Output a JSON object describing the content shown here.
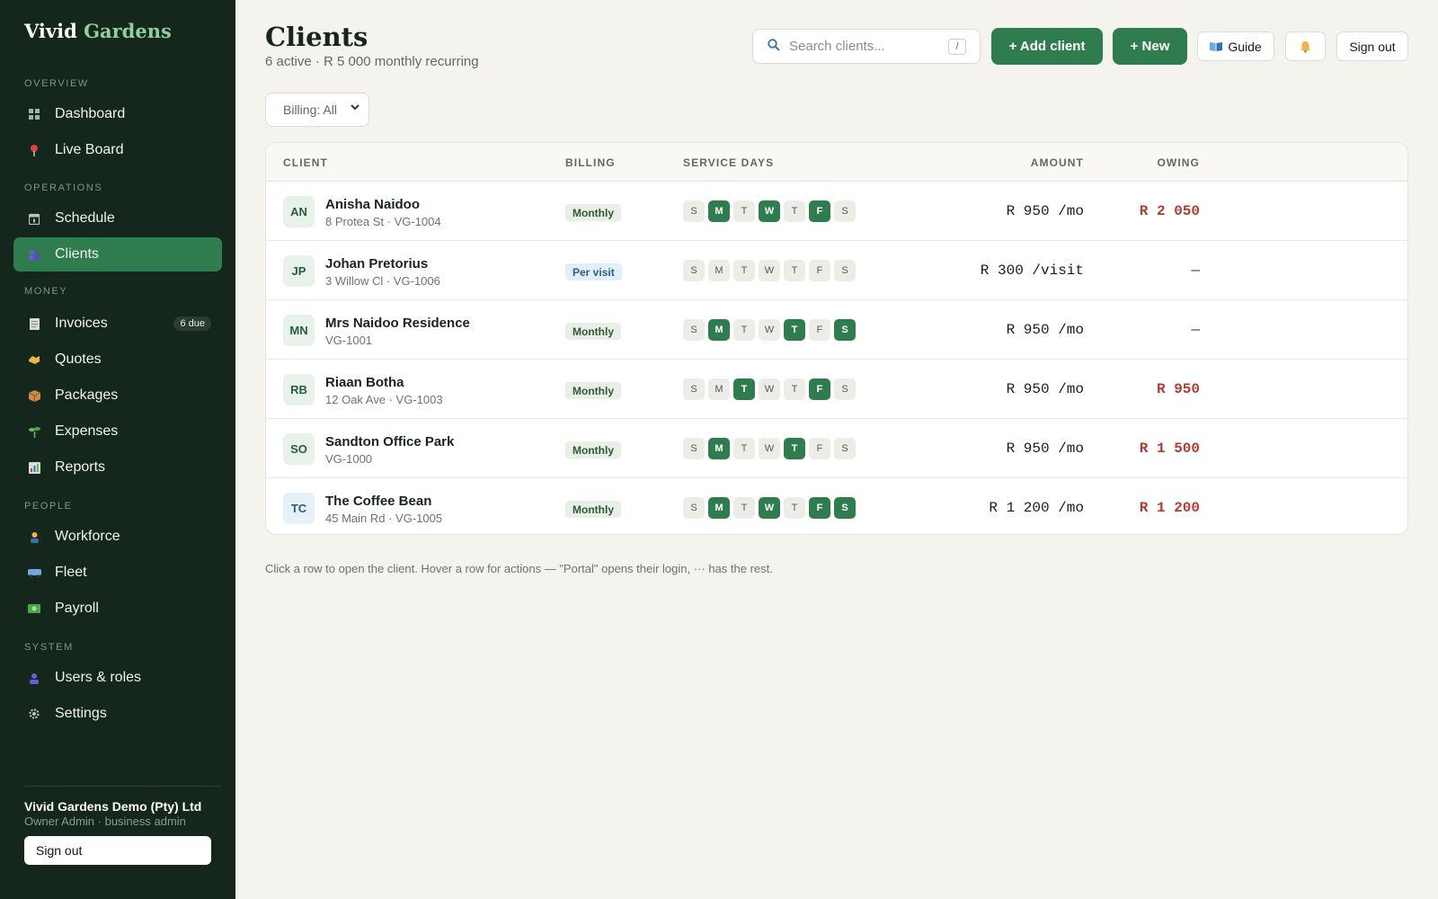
{
  "brand": {
    "name": "Vivid",
    "accent": "Gardens"
  },
  "sidebar": {
    "sections": [
      {
        "label": "OVERVIEW",
        "items": [
          {
            "label": "Dashboard",
            "icon": "grid-icon"
          },
          {
            "label": "Live Board",
            "icon": "pin-icon"
          }
        ]
      },
      {
        "label": "OPERATIONS",
        "items": [
          {
            "label": "Schedule",
            "icon": "calendar-icon"
          },
          {
            "label": "Clients",
            "icon": "people-icon",
            "active": true
          }
        ]
      },
      {
        "label": "MONEY",
        "items": [
          {
            "label": "Invoices",
            "icon": "receipt-icon",
            "badge": "6 due"
          },
          {
            "label": "Quotes",
            "icon": "handshake-icon"
          },
          {
            "label": "Packages",
            "icon": "package-icon"
          },
          {
            "label": "Expenses",
            "icon": "sprout-icon"
          },
          {
            "label": "Reports",
            "icon": "chart-icon"
          }
        ]
      },
      {
        "label": "PEOPLE",
        "items": [
          {
            "label": "Workforce",
            "icon": "worker-icon"
          },
          {
            "label": "Fleet",
            "icon": "van-icon"
          },
          {
            "label": "Payroll",
            "icon": "cash-icon"
          }
        ]
      },
      {
        "label": "SYSTEM",
        "items": [
          {
            "label": "Users & roles",
            "icon": "user-icon"
          },
          {
            "label": "Settings",
            "icon": "gear-icon"
          }
        ]
      }
    ],
    "org_name": "Vivid Gardens Demo (Pty) Ltd",
    "org_role": "Owner Admin · business admin",
    "sign_out": "Sign out"
  },
  "header": {
    "title": "Clients",
    "subtitle": "6 active · R 5 000 monthly recurring",
    "search_placeholder": "Search clients...",
    "search_shortcut": "/",
    "add_client": "+ Add client",
    "new": "+ New",
    "guide": "Guide",
    "sign_out": "Sign out"
  },
  "filter": {
    "label": "Billing: All"
  },
  "table": {
    "columns": {
      "client": "CLIENT",
      "billing": "BILLING",
      "service_days": "SERVICE DAYS",
      "amount": "AMOUNT",
      "owing": "OWING"
    },
    "day_letters": [
      "S",
      "M",
      "T",
      "W",
      "T",
      "F",
      "S"
    ],
    "rows": [
      {
        "initials": "AN",
        "name": "Anisha Naidoo",
        "address": "8 Protea St · VG-1004",
        "billing": "Monthly",
        "days": [
          0,
          1,
          0,
          1,
          0,
          1,
          0
        ],
        "amount": "R 950 /mo",
        "owing": "R 2 050"
      },
      {
        "initials": "JP",
        "name": "Johan Pretorius",
        "address": "3 Willow Cl · VG-1006",
        "billing": "Per visit",
        "days": [
          0,
          0,
          0,
          0,
          0,
          0,
          0
        ],
        "amount": "R 300 /visit",
        "owing": "—"
      },
      {
        "initials": "MN",
        "name": "Mrs Naidoo Residence",
        "address": "VG-1001",
        "billing": "Monthly",
        "days": [
          0,
          1,
          0,
          0,
          1,
          0,
          1
        ],
        "amount": "R 950 /mo",
        "owing": "—"
      },
      {
        "initials": "RB",
        "name": "Riaan Botha",
        "address": "12 Oak Ave · VG-1003",
        "billing": "Monthly",
        "days": [
          0,
          0,
          1,
          0,
          0,
          1,
          0
        ],
        "amount": "R 950 /mo",
        "owing": "R 950"
      },
      {
        "initials": "SO",
        "name": "Sandton Office Park",
        "address": "VG-1000",
        "billing": "Monthly",
        "days": [
          0,
          1,
          0,
          0,
          1,
          0,
          0
        ],
        "amount": "R 950 /mo",
        "owing": "R 1 500"
      },
      {
        "initials": "TC",
        "name": "The Coffee Bean",
        "address": "45 Main Rd · VG-1005",
        "billing": "Monthly",
        "days": [
          0,
          1,
          0,
          1,
          0,
          1,
          1
        ],
        "amount": "R 1 200 /mo",
        "owing": "R 1 200"
      }
    ]
  },
  "hint": "Click a row to open the client. Hover a row for actions — \"Portal\" opens their login, ··· has the rest.",
  "colors": {
    "sidebar_bg": "#15261c",
    "accent_green": "#2f7d4f",
    "owing_red": "#b23b32",
    "page_bg": "#f4f3ee"
  }
}
